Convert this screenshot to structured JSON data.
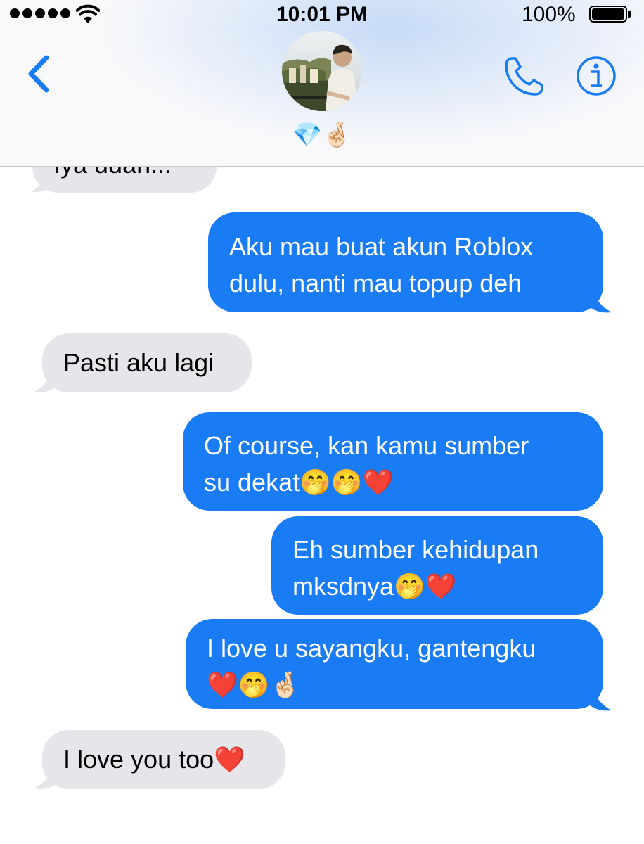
{
  "status_bar": {
    "time": "10:01 PM",
    "battery": "100%"
  },
  "header": {
    "contact_name": "💎🤞🏻",
    "icons": {
      "back": "chevron-left-icon",
      "phone": "phone-icon",
      "info": "info-icon"
    },
    "accent_color": "#1a7cf5"
  },
  "messages": [
    {
      "direction": "received",
      "text": "Iya udah..."
    },
    {
      "direction": "sent",
      "text": "Aku mau buat akun Roblox\ndulu, nanti mau topup deh"
    },
    {
      "direction": "received",
      "text": "Pasti aku lagi"
    },
    {
      "direction": "sent",
      "text": "Of course, kan kamu sumber\nsu dekat🤭🤭❤️"
    },
    {
      "direction": "sent",
      "text": "Eh sumber kehidupan\nmksdnya🤭❤️"
    },
    {
      "direction": "sent",
      "text": "I love u sayangku, gantengku\n❤️🤭🤞🏻"
    },
    {
      "direction": "received",
      "text": "I love you too❤️"
    }
  ],
  "colors": {
    "sent_bubble": "#1a7cf5",
    "received_bubble": "#e5e5ea"
  }
}
